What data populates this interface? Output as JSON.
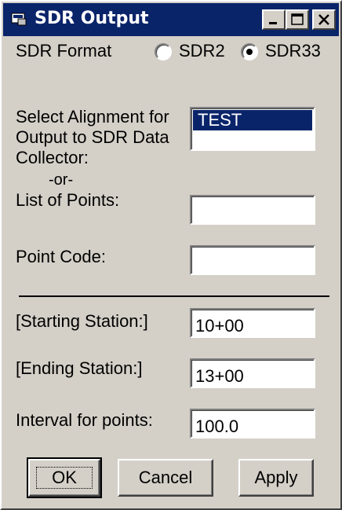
{
  "window": {
    "title": "SDR Output",
    "icon": "sdr-app-icon",
    "controls": [
      "minimize-icon",
      "maximize-icon",
      "close-icon"
    ]
  },
  "format": {
    "label": "SDR Format",
    "options": [
      {
        "label": "SDR2",
        "selected": false
      },
      {
        "label": "SDR33",
        "selected": true
      }
    ]
  },
  "alignment": {
    "label_line1": "Select Alignment for",
    "label_line2": "Output to SDR Data",
    "label_line3": "Collector:",
    "items": [
      "TEST"
    ],
    "selected_index": 0
  },
  "or_label": "-or-",
  "points": {
    "label": "List of Points:",
    "value": ""
  },
  "point_code": {
    "label": "Point Code:",
    "value": ""
  },
  "starting_station": {
    "label": "[Starting Station:]",
    "value": "10+00"
  },
  "ending_station": {
    "label": "[Ending Station:]",
    "value": "13+00"
  },
  "interval": {
    "label": "Interval for points:",
    "value": "100.0"
  },
  "buttons": {
    "ok": "OK",
    "cancel": "Cancel",
    "apply": "Apply"
  },
  "colors": {
    "titlebar": "#0a246a",
    "face": "#d4d0c8",
    "selection": "#0a246a"
  }
}
